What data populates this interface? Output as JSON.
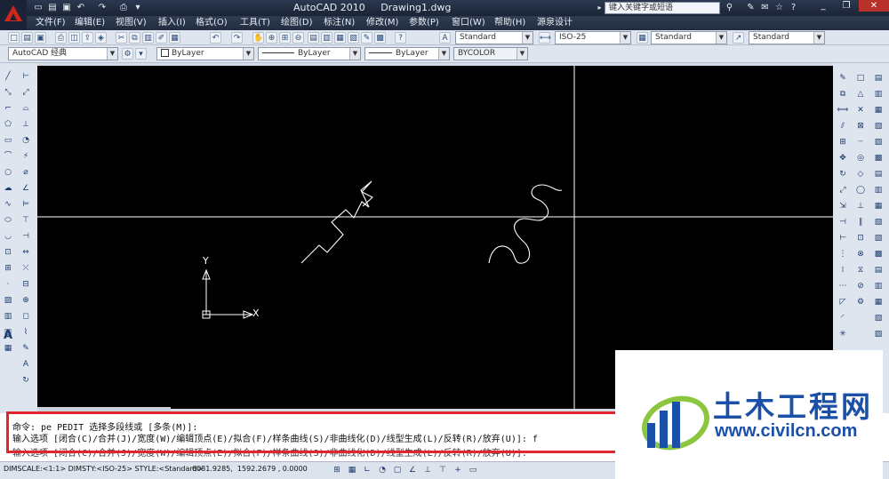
{
  "window": {
    "app_name": "AutoCAD 2010",
    "doc_name": "Drawing1.dwg",
    "search_placeholder": "键入关键字或短语"
  },
  "menu": [
    "文件(F)",
    "编辑(E)",
    "视图(V)",
    "插入(I)",
    "格式(O)",
    "工具(T)",
    "绘图(D)",
    "标注(N)",
    "修改(M)",
    "参数(P)",
    "窗口(W)",
    "帮助(H)",
    "源泉设计"
  ],
  "styles": {
    "text_style": "Standard",
    "dim_style": "ISO-25",
    "table_style": "Standard",
    "multileader_style": "Standard"
  },
  "properties": {
    "workspace": "AutoCAD 经典",
    "layer": "ByLayer",
    "linetype": "ByLayer",
    "lineweight": "ByLayer",
    "plotstyle": "BYCOLOR"
  },
  "ucs": {
    "x_label": "X",
    "y_label": "Y"
  },
  "command": {
    "line1": "命令: pe PEDIT 选择多段线或 [多条(M)]:",
    "line2": "输入选项 [闭合(C)/合并(J)/宽度(W)/编辑顶点(E)/拟合(F)/样条曲线(S)/非曲线化(D)/线型生成(L)/反转(R)/放弃(U)]: f",
    "line3": "输入选项 [闭合(C)/合并(J)/宽度(W)/编辑顶点(E)/拟合(F)/样条曲线(S)/非曲线化(D)/线型生成(L)/反转(R)/放弃(U)]:"
  },
  "status": {
    "left": "DIMSCALE:<1:1> DIMSTY:<ISO-25> STYLE:<Standard>",
    "coords": "6081.9285,  1592.2679 , 0.0000"
  },
  "watermark": {
    "title": "土木工程网",
    "url": "www.civilcn.com"
  },
  "colors": {
    "canvas_bg": "#000000",
    "highlight_box": "#e2262b",
    "watermark_blue": "#1a50a8"
  }
}
